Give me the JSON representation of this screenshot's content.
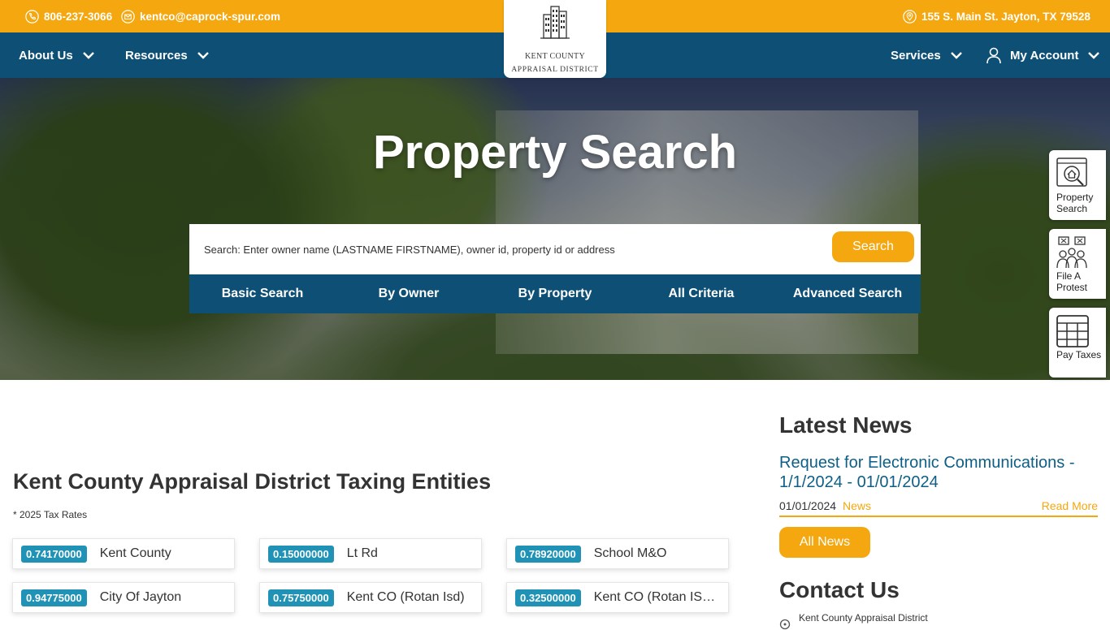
{
  "header": {
    "phone": "806-237-3066",
    "email": "kentco@caprock-spur.com",
    "address": "155 S. Main St. Jayton, TX 79528"
  },
  "logo": {
    "line1": "KENT COUNTY",
    "line2": "APPRAISAL DISTRICT"
  },
  "nav": {
    "about": "About Us",
    "resources": "Resources",
    "services": "Services",
    "account": "My Account"
  },
  "hero": {
    "title": "Property Search",
    "search_placeholder": "Search: Enter owner name (LASTNAME FIRSTNAME), owner id, property id or address",
    "search_button": "Search",
    "tabs": [
      "Basic Search",
      "By Owner",
      "By Property",
      "All Criteria",
      "Advanced Search"
    ]
  },
  "quick_links": [
    {
      "label": "Property Search",
      "icon": "house-search-icon"
    },
    {
      "label": "File A Protest",
      "icon": "protest-icon"
    },
    {
      "label": "Pay Taxes",
      "icon": "calendar-grid-icon"
    }
  ],
  "entities": {
    "title": "Kent County Appraisal District Taxing Entities",
    "note": "* 2025 Tax Rates",
    "items": [
      {
        "rate": "0.74170000",
        "name": "Kent County"
      },
      {
        "rate": "0.15000000",
        "name": "Lt Rd"
      },
      {
        "rate": "0.78920000",
        "name": "School M&O"
      },
      {
        "rate": "0.94775000",
        "name": "City Of Jayton"
      },
      {
        "rate": "0.75750000",
        "name": "Kent CO (Rotan Isd)"
      },
      {
        "rate": "0.32500000",
        "name": "Kent CO (Rotan IS…"
      }
    ]
  },
  "news": {
    "heading": "Latest News",
    "item_title": "Request for Electronic Communications - 1/1/2024 - 01/01/2024",
    "item_date": "01/01/2024",
    "item_category": "News",
    "read_more": "Read More",
    "all_news": "All News"
  },
  "contact": {
    "heading": "Contact Us",
    "line": "Kent County Appraisal District"
  },
  "colors": {
    "accent": "#f5a70f",
    "nav": "#0d4f75",
    "rate_badge": "#1f92b5",
    "link": "#0d5f87"
  }
}
